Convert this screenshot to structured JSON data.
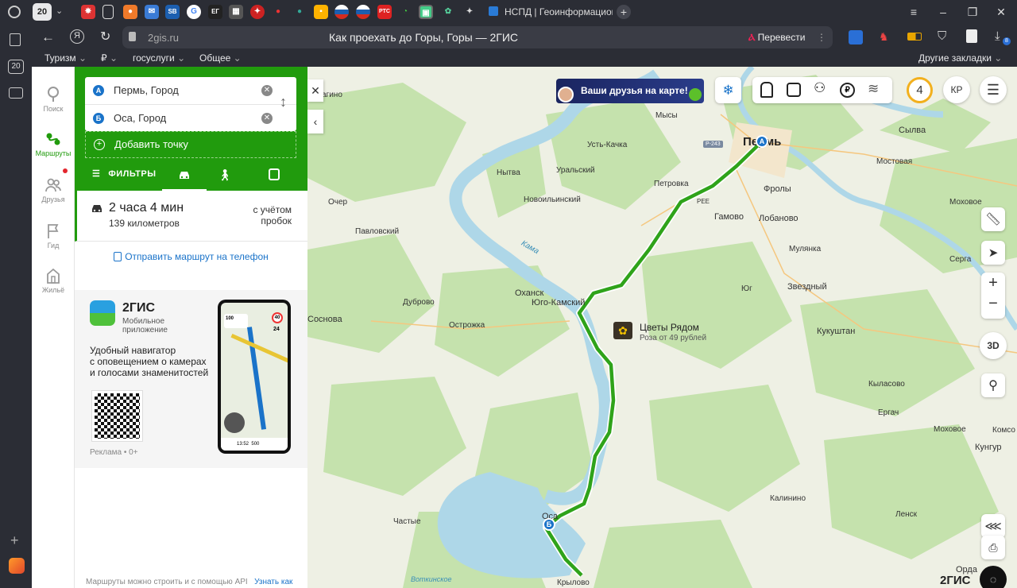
{
  "browser": {
    "tab_count": "20",
    "active_tab_title": "НСПД | Геоинформацион",
    "url": "2gis.ru",
    "page_title": "Как проехать до Горы, Горы — 2ГИС",
    "translate_label": "Перевести",
    "bookmarks": [
      "Туризм",
      "₽",
      "госуслуги",
      "Общее"
    ],
    "other_bookmarks": "Другие закладки",
    "side_badge": "20",
    "ext_badge": "8"
  },
  "nav": {
    "items": [
      {
        "label": "Поиск",
        "icon": "search-icon"
      },
      {
        "label": "Маршруты",
        "icon": "routes-icon"
      },
      {
        "label": "Друзья",
        "icon": "friends-icon"
      },
      {
        "label": "Гид",
        "icon": "flag-icon"
      },
      {
        "label": "Жильё",
        "icon": "home-icon"
      }
    ]
  },
  "route": {
    "from_marker": "A",
    "to_marker": "Б",
    "from": "Пермь, Город",
    "to": "Оса, Город",
    "add_point": "Добавить точку",
    "filters": "ФИЛЬТРЫ",
    "duration": "2 часа 4 мин",
    "distance": "139 километров",
    "traffic_note_1": "с учётом",
    "traffic_note_2": "пробок",
    "send_to_phone": "Отправить маршрут на телефон"
  },
  "ad": {
    "brand": "2ГИС",
    "subtitle_1": "Мобильное",
    "subtitle_2": "приложение",
    "text_1": "Удобный навигатор",
    "text_2": "с оповещением о камерах",
    "text_3": "и голосами знаменитостей",
    "label": "Реклама • 0+",
    "phone_speed": "100",
    "phone_limit": "40",
    "phone_dist": "24",
    "phone_time": "13:52",
    "phone_km": "500"
  },
  "footer": {
    "api_note": "Маршруты можно строить и с помощью API",
    "learn_how": "Узнать как"
  },
  "map": {
    "friends_banner": "Ваши друзья на карте!",
    "traffic_score": "4",
    "avatar": "КР",
    "btn_3d": "3D",
    "logo": "2ГИС",
    "poi_name": "Цветы Рядом",
    "poi_sub": "Роза от 49 рублей",
    "road_sign": "Р-243",
    "marker_a": "A",
    "marker_b": "Б",
    "labels": {
      "perm": "Пермь",
      "agino": "агино",
      "mysy": "Мысы",
      "ust_kachka": "Усть-Качка",
      "uralsky": "Уральский",
      "nytva": "Нытва",
      "novoilyinsky": "Новоильинский",
      "ocher": "Очер",
      "pavlovsky": "Павловский",
      "kama": "Кама",
      "petrovka": "Петровка",
      "ree": "РЕЕ",
      "gamovo": "Гамово",
      "lobanovo": "Лобаново",
      "frolы": "Фролы",
      "sylva": "Сылва",
      "mostovaya": "Мостовая",
      "mokhovoe": "Моховое",
      "mulyanka": "Мулянка",
      "serga": "Серга",
      "zvezdny": "Звездный",
      "yug": "Юг",
      "okhansk": "Оханск",
      "yugo_kamsky": "Юго-Камский",
      "dubrovo": "Дуброво",
      "ostrozhka": "Острожка",
      "sosnova": "Соснова",
      "kukushtan": "Кукуштан",
      "kylasovo": "Кыласово",
      "ergach": "Ергач",
      "mokhovoe2": "Моховое",
      "komsomolsky": "Комсо",
      "kungur": "Кунгур",
      "kalinino": "Калинино",
      "lensk": "Ленск",
      "osa": "Оса",
      "chastye": "Частые",
      "krylovo": "Крылово",
      "votkinsk": "Воткинское",
      "orda": "Орда"
    }
  }
}
